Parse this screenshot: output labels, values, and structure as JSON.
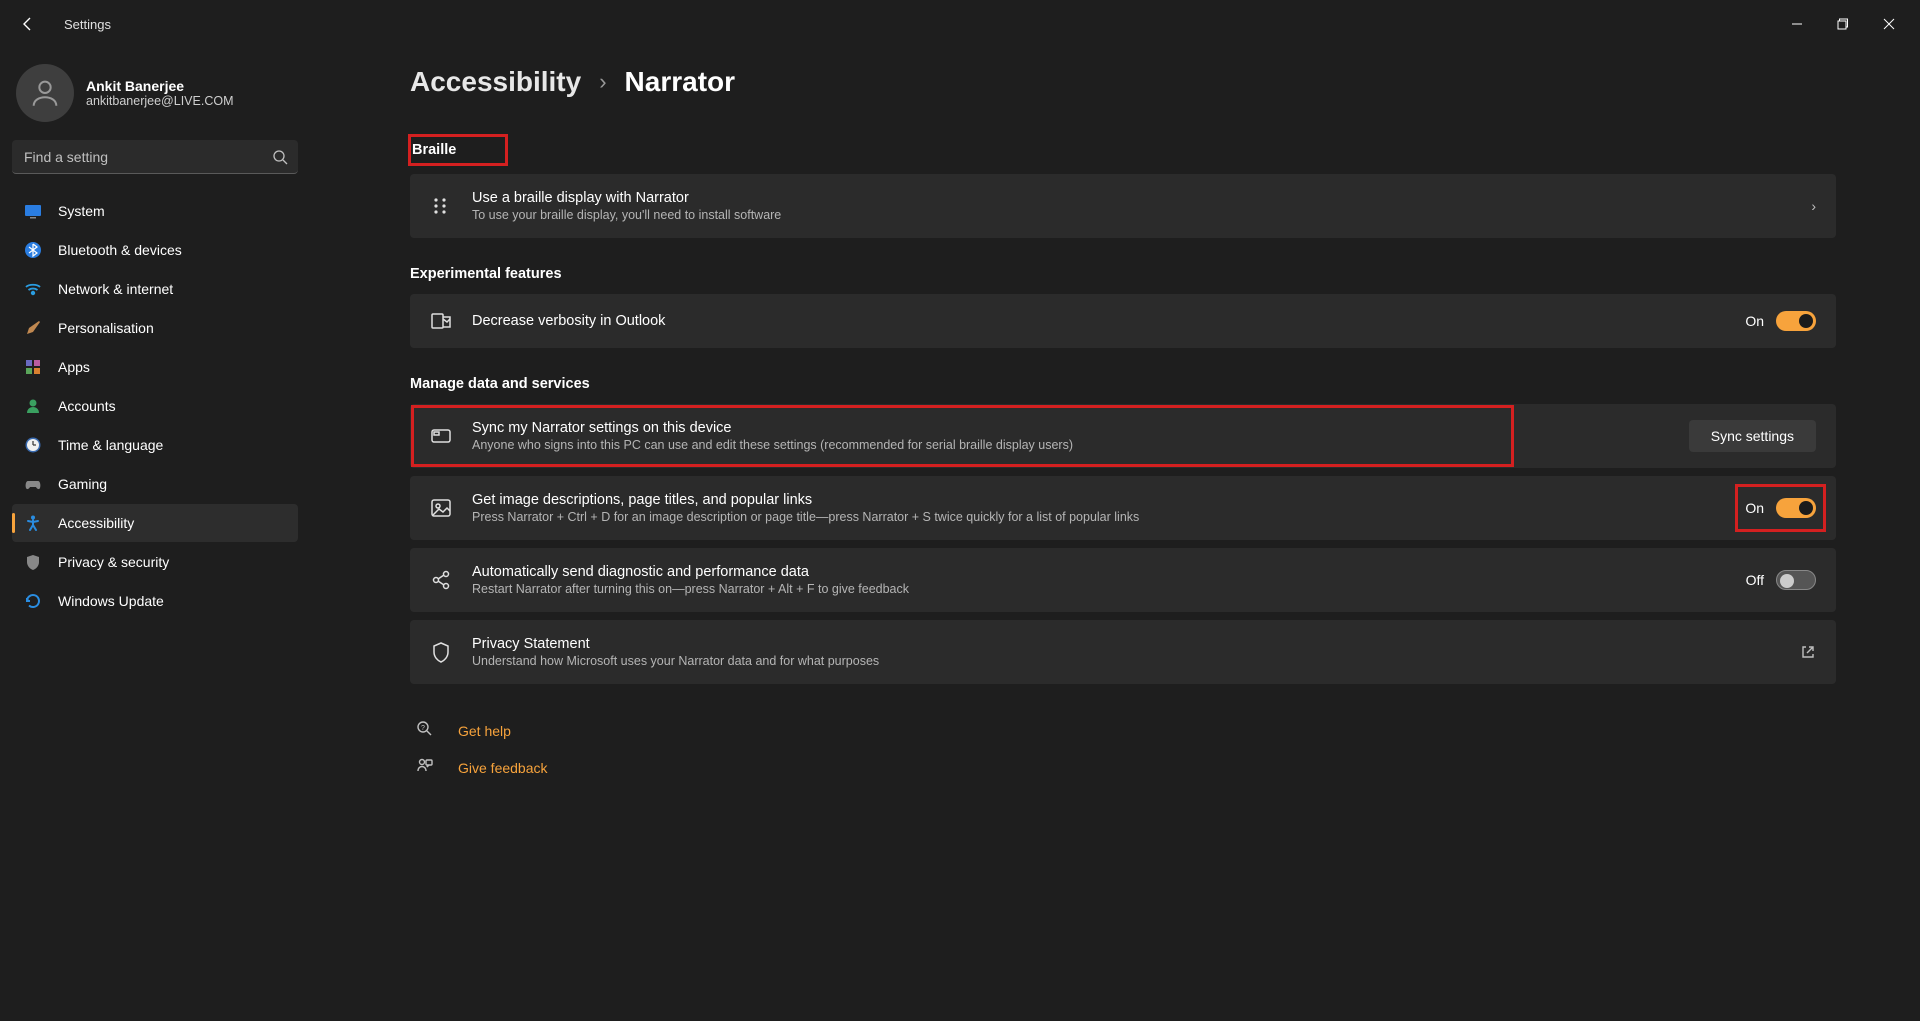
{
  "titlebar": {
    "title": "Settings"
  },
  "profile": {
    "name": "Ankit Banerjee",
    "email": "ankitbanerjee@LIVE.COM"
  },
  "search": {
    "placeholder": "Find a setting"
  },
  "nav": {
    "items": [
      {
        "label": "System"
      },
      {
        "label": "Bluetooth & devices"
      },
      {
        "label": "Network & internet"
      },
      {
        "label": "Personalisation"
      },
      {
        "label": "Apps"
      },
      {
        "label": "Accounts"
      },
      {
        "label": "Time & language"
      },
      {
        "label": "Gaming"
      },
      {
        "label": "Accessibility"
      },
      {
        "label": "Privacy & security"
      },
      {
        "label": "Windows Update"
      }
    ]
  },
  "breadcrumb": {
    "parent": "Accessibility",
    "current": "Narrator"
  },
  "sections": {
    "braille": {
      "title": "Braille",
      "card": {
        "title": "Use a braille display with Narrator",
        "sub": "To use your braille display, you'll need to install software"
      }
    },
    "experimental": {
      "title": "Experimental features",
      "card": {
        "title": "Decrease verbosity in Outlook",
        "state": "On"
      }
    },
    "manage": {
      "title": "Manage data and services",
      "sync": {
        "title": "Sync my Narrator settings on this device",
        "sub": "Anyone who signs into this PC can use and edit these settings (recommended for serial braille display users)",
        "button": "Sync settings"
      },
      "image_desc": {
        "title": "Get image descriptions, page titles, and popular links",
        "sub": "Press Narrator + Ctrl + D for an image description or page title—press Narrator + S twice quickly for a list of popular links",
        "state": "On"
      },
      "diagnostic": {
        "title": "Automatically send diagnostic and performance data",
        "sub": "Restart Narrator after turning this on—press Narrator + Alt + F to give feedback",
        "state": "Off"
      },
      "privacy": {
        "title": "Privacy Statement",
        "sub": "Understand how Microsoft uses your Narrator data and for what purposes"
      }
    }
  },
  "links": {
    "help": "Get help",
    "feedback": "Give feedback"
  }
}
